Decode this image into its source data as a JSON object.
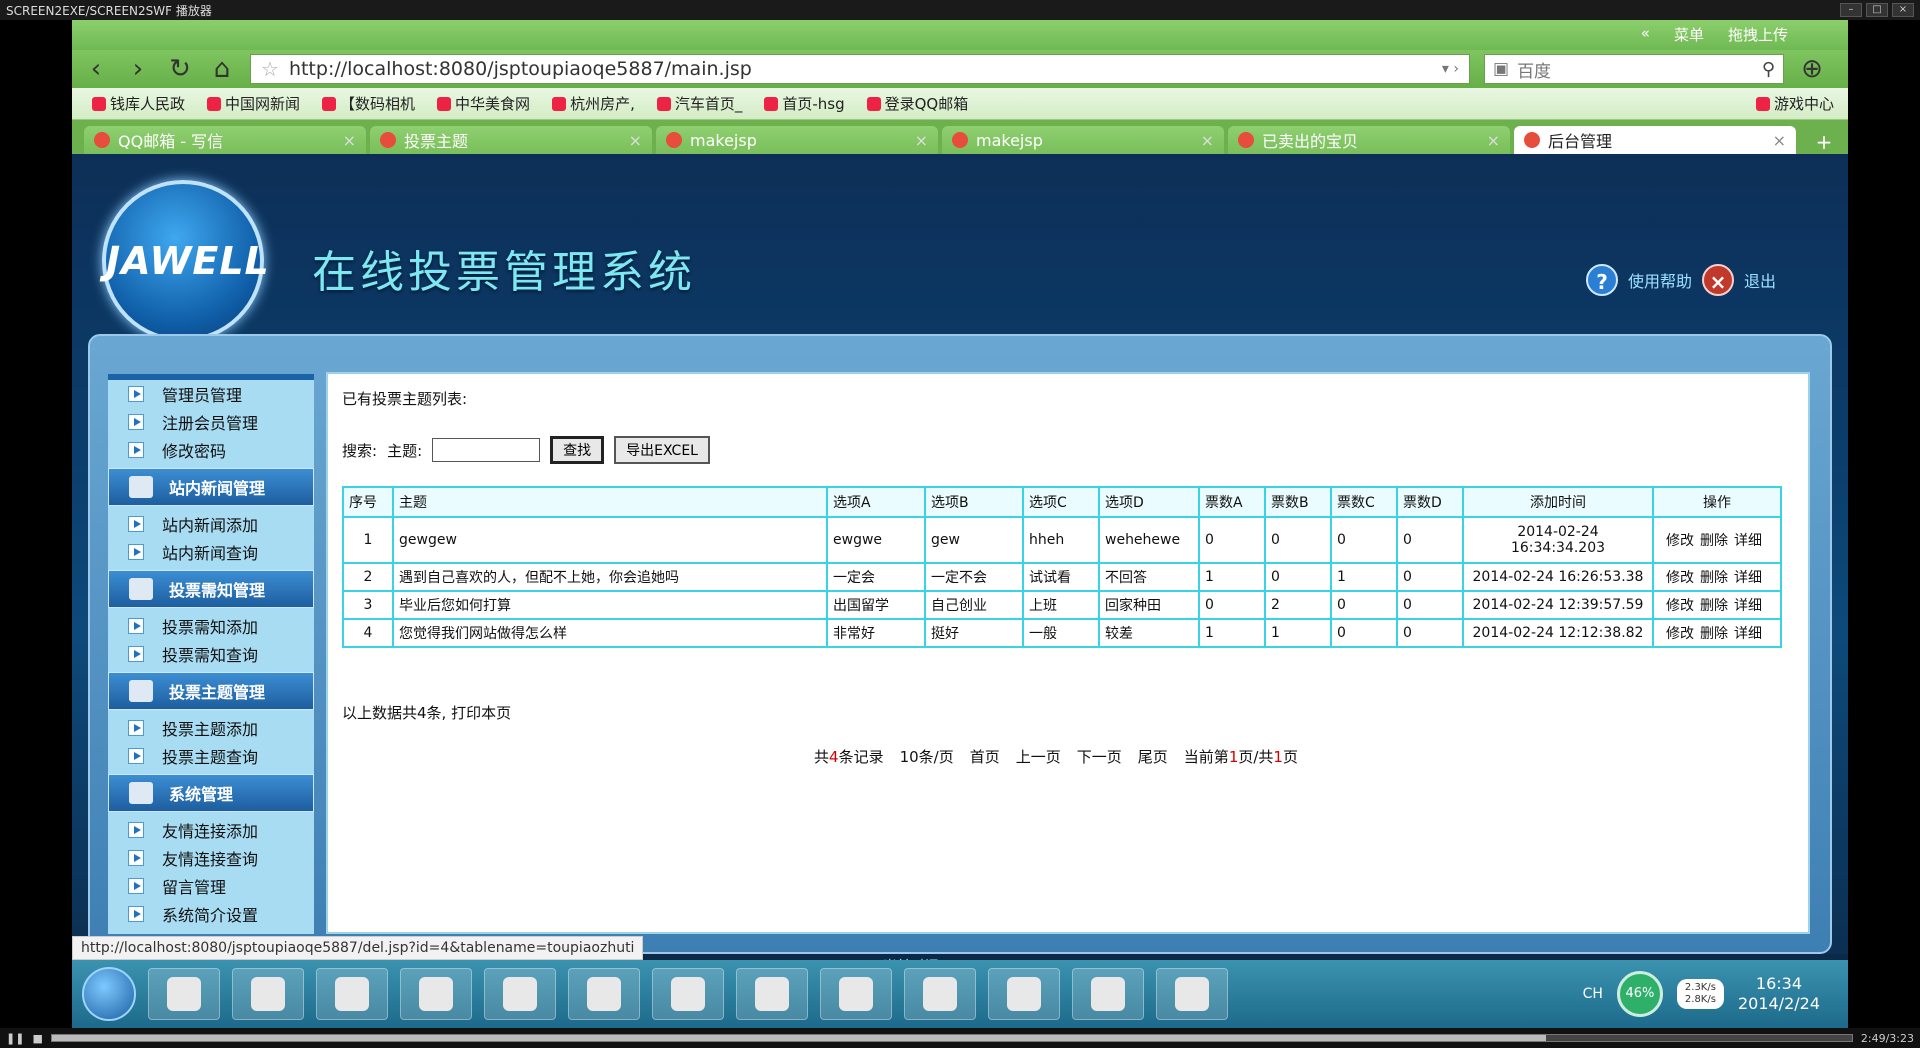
{
  "player": {
    "title": "SCREEN2EXE/SCREEN2SWF 播放器",
    "time": "2:49/3:23",
    "progress_fraction": 0.83
  },
  "browser": {
    "url": "http://localhost:8080/jsptoupiaoqe5887/main.jsp",
    "search_placeholder": "百度",
    "menu_label": "菜单",
    "upload_label": "拖拽上传",
    "bookmarks": [
      "钱库人民政",
      "中国网新闻",
      "【数码相机",
      "中华美食网",
      "杭州房产,",
      "汽车首页_",
      "首页-hsg",
      "登录QQ邮箱"
    ],
    "bookmarks_right": "游戏中心",
    "tabs": [
      "QQ邮箱 - 写信",
      "投票主题",
      "makejsp",
      "makejsp",
      "已卖出的宝贝",
      "后台管理"
    ],
    "status_url": "http://localhost:8080/jsptoupiaoqe5887/del.jsp?id=4&tablename=toupiaozhuti"
  },
  "header": {
    "logo_text": "JAWELL",
    "title": "在线投票管理系统",
    "help_label": "使用帮助",
    "exit_label": "退出"
  },
  "sidebar": {
    "top_items": [
      "管理员管理",
      "注册会员管理",
      "修改密码"
    ],
    "groups": [
      {
        "title": "站内新闻管理",
        "items": [
          "站内新闻添加",
          "站内新闻查询"
        ]
      },
      {
        "title": "投票需知管理",
        "items": [
          "投票需知添加",
          "投票需知查询"
        ]
      },
      {
        "title": "投票主题管理",
        "items": [
          "投票主题添加",
          "投票主题查询"
        ]
      },
      {
        "title": "系统管理",
        "items": [
          "友情连接添加",
          "友情连接查询",
          "留言管理",
          "系统简介设置"
        ]
      }
    ]
  },
  "content": {
    "list_title": "已有投票主题列表:",
    "search_label": "搜索:",
    "subject_label": "主题:",
    "subject_value": "",
    "find_button": "查找",
    "export_button": "导出EXCEL",
    "columns": [
      "序号",
      "主题",
      "选项A",
      "选项B",
      "选项C",
      "选项D",
      "票数A",
      "票数B",
      "票数C",
      "票数D",
      "添加时间",
      "操作"
    ],
    "rows": [
      {
        "no": "1",
        "subject": "gewgew",
        "a": "ewgwe",
        "b": "gew",
        "c": "hheh",
        "d": "wehehewe",
        "va": "0",
        "vb": "0",
        "vc": "0",
        "vd": "0",
        "time1": "2014-02-24",
        "time2": "16:34:34.203"
      },
      {
        "no": "2",
        "subject": "遇到自己喜欢的人，但配不上她，你会追她吗",
        "a": "一定会",
        "b": "一定不会",
        "c": "试试看",
        "d": "不回答",
        "va": "1",
        "vb": "0",
        "vc": "1",
        "vd": "0",
        "time1": "2014-02-24 16:26:53.38",
        "time2": ""
      },
      {
        "no": "3",
        "subject": "毕业后您如何打算",
        "a": "出国留学",
        "b": "自己创业",
        "c": "上班",
        "d": "回家种田",
        "va": "0",
        "vb": "2",
        "vc": "0",
        "vd": "0",
        "time1": "2014-02-24 12:39:57.59",
        "time2": ""
      },
      {
        "no": "4",
        "subject": "您觉得我们网站做得怎么样",
        "a": "非常好",
        "b": "挺好",
        "c": "一般",
        "d": "较差",
        "va": "1",
        "vb": "1",
        "vc": "0",
        "vd": "0",
        "time1": "2014-02-24 12:12:38.82",
        "time2": ""
      }
    ],
    "actions": [
      "修改",
      "删除",
      "详细"
    ],
    "summary": "以上数据共4条, 打印本页",
    "pager": {
      "total_prefix": "共",
      "total": "4",
      "total_suffix": "条记录",
      "per_page": "10条/页",
      "first": "首页",
      "prev": "上一页",
      "next": "下一页",
      "last": "尾页",
      "current_prefix": "当前第",
      "current": "1",
      "mid": "页/共",
      "pages": "1",
      "pages_suffix": "页"
    }
  },
  "footer": {
    "current_time": "当前时间:2014-02-24 04:34:37 PM"
  },
  "taskbar": {
    "cpu": "46%",
    "net_up": "2.3K/s",
    "net_down": "2.8K/s",
    "lang": "CH",
    "clock_time": "16:34",
    "clock_date": "2014/2/24"
  }
}
